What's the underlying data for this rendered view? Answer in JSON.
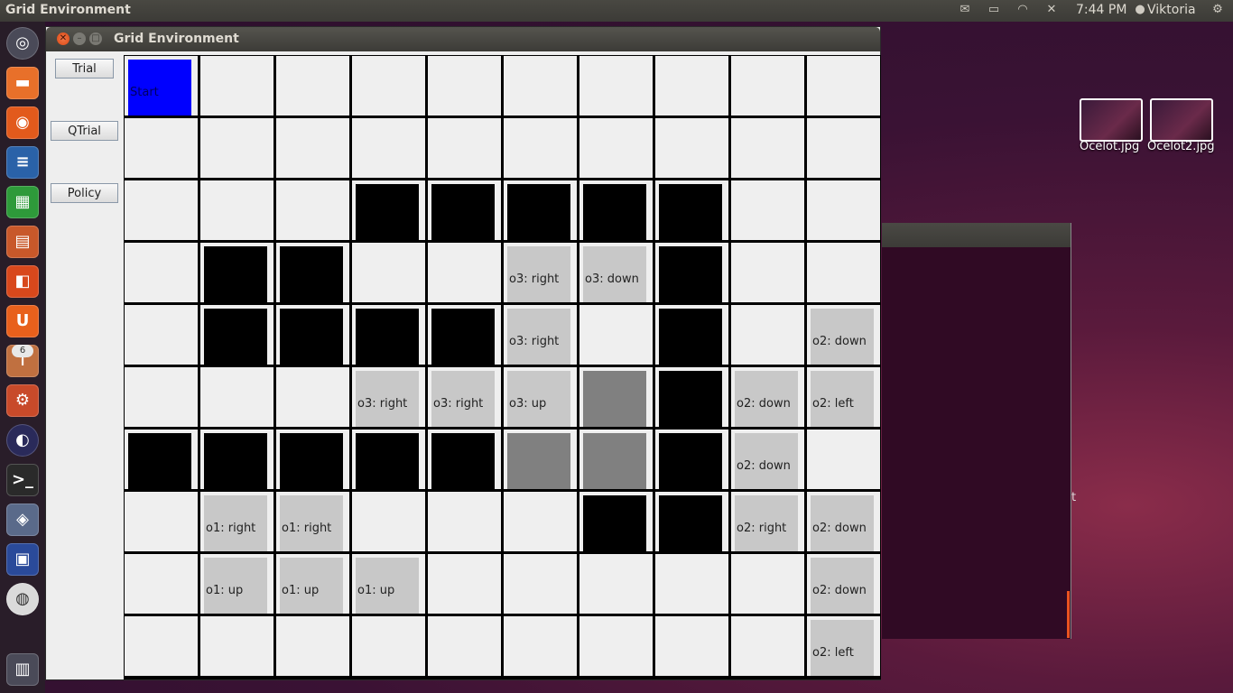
{
  "panel": {
    "window_title": "Grid Environment",
    "time": "7:44 PM",
    "user": "Viktoria"
  },
  "launcher": {
    "badge_count": "6"
  },
  "desktop": {
    "files": [
      "Ocelot.jpg",
      "Ocelot2.jpg"
    ]
  },
  "bg_window": {
    "visible_text": "t"
  },
  "window": {
    "title": "Grid Environment",
    "buttons": {
      "trial": "Trial",
      "qtrial": "QTrial",
      "policy": "Policy"
    }
  },
  "grid": {
    "rows": 10,
    "cols": 10,
    "colors": {
      "empty": "#efefef",
      "wall": "#000000",
      "path": "#c8c8c8",
      "dark": "#808080",
      "start": "#0000ff"
    },
    "cells": [
      [
        {
          "t": "start",
          "label": "Start"
        },
        {
          "t": "empty"
        },
        {
          "t": "empty"
        },
        {
          "t": "empty"
        },
        {
          "t": "empty"
        },
        {
          "t": "empty"
        },
        {
          "t": "empty"
        },
        {
          "t": "empty"
        },
        {
          "t": "empty"
        },
        {
          "t": "empty"
        }
      ],
      [
        {
          "t": "empty"
        },
        {
          "t": "empty"
        },
        {
          "t": "empty"
        },
        {
          "t": "empty"
        },
        {
          "t": "empty"
        },
        {
          "t": "empty"
        },
        {
          "t": "empty"
        },
        {
          "t": "empty"
        },
        {
          "t": "empty"
        },
        {
          "t": "empty"
        }
      ],
      [
        {
          "t": "empty"
        },
        {
          "t": "empty"
        },
        {
          "t": "empty"
        },
        {
          "t": "wall"
        },
        {
          "t": "wall"
        },
        {
          "t": "wall"
        },
        {
          "t": "wall"
        },
        {
          "t": "wall"
        },
        {
          "t": "empty"
        },
        {
          "t": "empty"
        }
      ],
      [
        {
          "t": "empty"
        },
        {
          "t": "wall"
        },
        {
          "t": "wall"
        },
        {
          "t": "empty"
        },
        {
          "t": "empty"
        },
        {
          "t": "path",
          "label": "o3: right"
        },
        {
          "t": "path",
          "label": "o3: down"
        },
        {
          "t": "wall"
        },
        {
          "t": "empty"
        },
        {
          "t": "empty"
        }
      ],
      [
        {
          "t": "empty"
        },
        {
          "t": "wall"
        },
        {
          "t": "wall"
        },
        {
          "t": "wall"
        },
        {
          "t": "wall"
        },
        {
          "t": "path",
          "label": "o3: right"
        },
        {
          "t": "empty"
        },
        {
          "t": "wall"
        },
        {
          "t": "empty"
        },
        {
          "t": "path",
          "label": "o2: down"
        }
      ],
      [
        {
          "t": "empty"
        },
        {
          "t": "empty"
        },
        {
          "t": "empty"
        },
        {
          "t": "path",
          "label": "o3: right"
        },
        {
          "t": "path",
          "label": "o3: right"
        },
        {
          "t": "path",
          "label": "o3: up"
        },
        {
          "t": "dark"
        },
        {
          "t": "wall"
        },
        {
          "t": "path",
          "label": "o2: down"
        },
        {
          "t": "path",
          "label": "o2: left"
        }
      ],
      [
        {
          "t": "wall"
        },
        {
          "t": "wall"
        },
        {
          "t": "wall"
        },
        {
          "t": "wall"
        },
        {
          "t": "wall"
        },
        {
          "t": "dark"
        },
        {
          "t": "dark"
        },
        {
          "t": "wall"
        },
        {
          "t": "path",
          "label": "o2: down"
        },
        {
          "t": "empty"
        }
      ],
      [
        {
          "t": "empty"
        },
        {
          "t": "path",
          "label": "o1: right"
        },
        {
          "t": "path",
          "label": "o1: right"
        },
        {
          "t": "empty"
        },
        {
          "t": "empty"
        },
        {
          "t": "empty"
        },
        {
          "t": "wall"
        },
        {
          "t": "wall"
        },
        {
          "t": "path",
          "label": "o2: right"
        },
        {
          "t": "path",
          "label": "o2: down"
        }
      ],
      [
        {
          "t": "empty"
        },
        {
          "t": "path",
          "label": "o1: up"
        },
        {
          "t": "path",
          "label": "o1: up"
        },
        {
          "t": "path",
          "label": "o1: up"
        },
        {
          "t": "empty"
        },
        {
          "t": "empty"
        },
        {
          "t": "empty"
        },
        {
          "t": "empty"
        },
        {
          "t": "empty"
        },
        {
          "t": "path",
          "label": "o2: down"
        }
      ],
      [
        {
          "t": "empty"
        },
        {
          "t": "empty"
        },
        {
          "t": "empty"
        },
        {
          "t": "empty"
        },
        {
          "t": "empty"
        },
        {
          "t": "empty"
        },
        {
          "t": "empty"
        },
        {
          "t": "empty"
        },
        {
          "t": "empty"
        },
        {
          "t": "path",
          "label": "o2: left"
        }
      ]
    ]
  }
}
